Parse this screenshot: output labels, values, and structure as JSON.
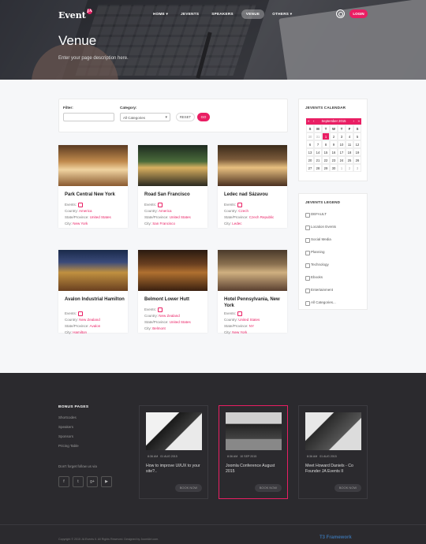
{
  "header": {
    "logo_text": "Event",
    "logo_badge": "JA",
    "nav": [
      {
        "label": "HOME ▾",
        "active": false
      },
      {
        "label": "JEVENTS",
        "active": false
      },
      {
        "label": "SPEAKERS",
        "active": false
      },
      {
        "label": "VENUE",
        "active": true
      },
      {
        "label": "OTHERS ▾",
        "active": false
      }
    ],
    "login_label": "LOGIN"
  },
  "hero": {
    "title": "Venue",
    "description": "Enter your page description here."
  },
  "filter": {
    "filter_label": "Filter:",
    "filter_value": "",
    "category_label": "Category:",
    "category_value": "All Categories",
    "reset_label": "RESET",
    "go_label": "GO"
  },
  "venues": [
    {
      "name": "Park Central New York",
      "events_label": "Events:",
      "country_label": "Country:",
      "country": "America",
      "state_label": "State/Province:",
      "state": "United States",
      "city_label": "City:",
      "city": "New York"
    },
    {
      "name": "Road San Francisco",
      "events_label": "Events:",
      "country_label": "Country:",
      "country": "America",
      "state_label": "State/Province:",
      "state": "United States",
      "city_label": "City:",
      "city": "San Francisco"
    },
    {
      "name": "Ledec nad Sázavou",
      "events_label": "Events:",
      "country_label": "Country:",
      "country": "Czech",
      "state_label": "State/Province:",
      "state": "Czech Republic",
      "city_label": "City:",
      "city": "Ledec"
    },
    {
      "name": "Avalon Industrial Hamilton",
      "events_label": "Events:",
      "country_label": "Country:",
      "country": "New Zealand",
      "state_label": "State/Province:",
      "state": "Avalon",
      "city_label": "City:",
      "city": "Hamilton"
    },
    {
      "name": "Belmont Lower Hutt",
      "events_label": "Events:",
      "country_label": "Country:",
      "country": "New Zealand",
      "state_label": "State/Province:",
      "state": "United States",
      "city_label": "City:",
      "city": "Belmont"
    },
    {
      "name": "Hotel Pennsylvania, New York",
      "events_label": "Events:",
      "country_label": "Country:",
      "country": "United States",
      "state_label": "State/Province:",
      "state": "NY",
      "city_label": "City:",
      "city": "New York"
    }
  ],
  "calendar": {
    "title": "JEVENTS CALENDAR",
    "prev_year": "«",
    "prev_month": "‹",
    "month_label": "September 2015",
    "next_month": "›",
    "next_year": "»",
    "weekdays": [
      "S",
      "M",
      "T",
      "W",
      "T",
      "F",
      "S"
    ],
    "days": [
      {
        "d": "30",
        "o": true
      },
      {
        "d": "31",
        "o": true
      },
      {
        "d": "1",
        "t": true
      },
      {
        "d": "2"
      },
      {
        "d": "3"
      },
      {
        "d": "4"
      },
      {
        "d": "5"
      },
      {
        "d": "6"
      },
      {
        "d": "7"
      },
      {
        "d": "8"
      },
      {
        "d": "9"
      },
      {
        "d": "10"
      },
      {
        "d": "11"
      },
      {
        "d": "12"
      },
      {
        "d": "13"
      },
      {
        "d": "14"
      },
      {
        "d": "15"
      },
      {
        "d": "16"
      },
      {
        "d": "17"
      },
      {
        "d": "18"
      },
      {
        "d": "19"
      },
      {
        "d": "20"
      },
      {
        "d": "21"
      },
      {
        "d": "22"
      },
      {
        "d": "23"
      },
      {
        "d": "24"
      },
      {
        "d": "25"
      },
      {
        "d": "26"
      },
      {
        "d": "27"
      },
      {
        "d": "28"
      },
      {
        "d": "29"
      },
      {
        "d": "30"
      },
      {
        "d": "1",
        "o": true
      },
      {
        "d": "2",
        "o": true
      },
      {
        "d": "3",
        "o": true
      }
    ]
  },
  "legend": {
    "title": "JEVENTS LEGEND",
    "items": [
      "DEFAULT",
      "Location Events",
      "Social Media",
      "Planning",
      "Technology",
      "Ebooks",
      "Entertainment",
      "All Categories..."
    ]
  },
  "footer": {
    "bonus_title": "BONUS PAGES",
    "links": [
      "Shortcodes",
      "Speakers",
      "Sponsors",
      "Pricing Table"
    ],
    "follow_text": "Don't forget follow us via",
    "social": [
      {
        "icon": "facebook-icon",
        "glyph": "f"
      },
      {
        "icon": "twitter-icon",
        "glyph": "t"
      },
      {
        "icon": "google-plus-icon",
        "glyph": "g+"
      },
      {
        "icon": "youtube-icon",
        "glyph": "▶"
      }
    ],
    "posts": [
      {
        "time": "8:36 AM",
        "date": "01 AUG 2015",
        "title": "How to improve UI/UX to your site?..",
        "button": "BOOK NOW",
        "highlight": false
      },
      {
        "time": "8:36 AM",
        "date": "10 SEP 2015",
        "title": "Joomla Conference August 2015",
        "button": "BOOK NOW",
        "highlight": true
      },
      {
        "time": "8:36 AM",
        "date": "01 AUG 2015",
        "title": "Meet Howard Daniels - Co Founder JA Events II",
        "button": "BOOK NOW",
        "highlight": false
      }
    ],
    "copyright": "Copyright © 2015 JA Events II. All Rights Reserved. Designed by JoomlArt.com.",
    "brand": "T3 Framework"
  },
  "colors": {
    "accent": "#e91e63",
    "footer_bg": "#2b2a2e"
  }
}
